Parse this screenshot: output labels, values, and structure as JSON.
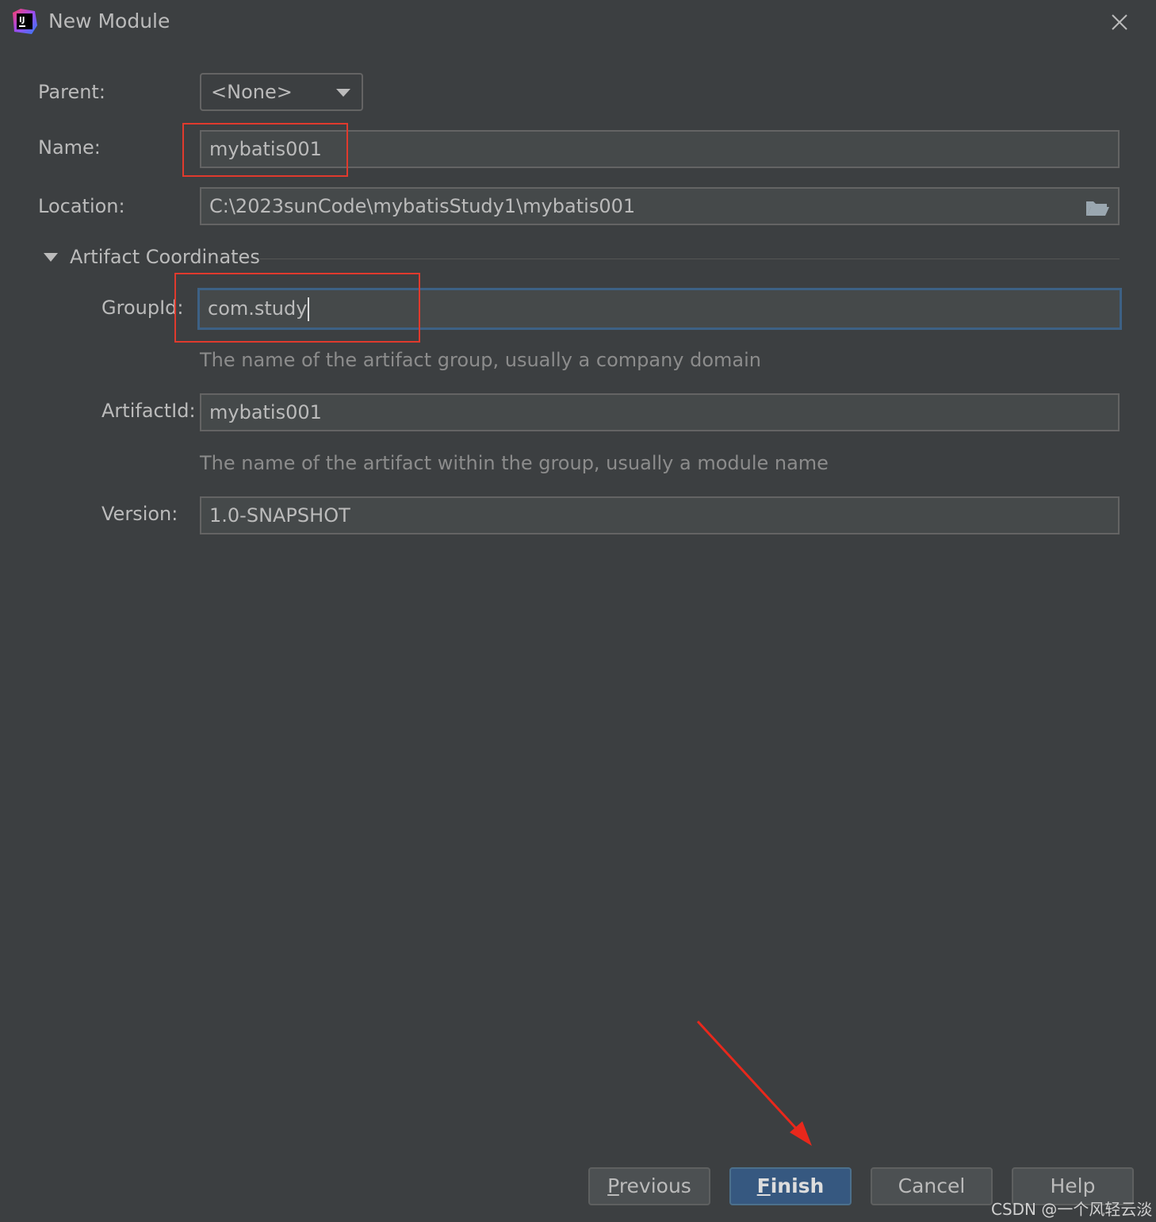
{
  "window": {
    "title": "New Module",
    "app_icon": "intellij-idea-icon",
    "close_icon": "close-icon"
  },
  "form": {
    "parent": {
      "label": "Parent:",
      "value": "<None>"
    },
    "name": {
      "label": "Name:",
      "value": "mybatis001"
    },
    "location": {
      "label": "Location:",
      "value": "C:\\2023sunCode\\mybatisStudy1\\mybatis001",
      "icon": "folder-icon"
    }
  },
  "artifact": {
    "section_title": "Artifact Coordinates",
    "group_id": {
      "label": "GroupId:",
      "value": "com.study",
      "hint": "The name of the artifact group, usually a company domain"
    },
    "artifact_id": {
      "label": "ArtifactId:",
      "value": "mybatis001",
      "hint": "The name of the artifact within the group, usually a module name"
    },
    "version": {
      "label": "Version:",
      "value": "1.0-SNAPSHOT"
    }
  },
  "buttons": {
    "previous": {
      "mnemonic": "P",
      "rest": "revious"
    },
    "finish": {
      "mnemonic": "F",
      "rest": "inish"
    },
    "cancel": "Cancel",
    "help": "Help"
  },
  "watermark": "CSDN @一个风轻云淡",
  "colors": {
    "annotation": "#e03a2d",
    "focus_border": "#3d6185",
    "primary_button": "#365880"
  }
}
